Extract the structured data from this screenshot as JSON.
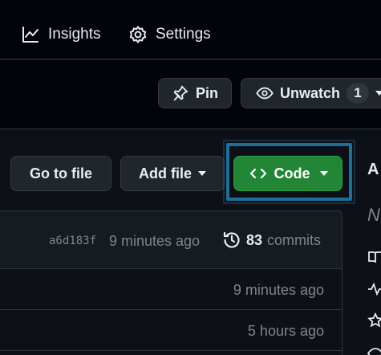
{
  "nav": {
    "insights_label": "Insights",
    "insights_icon": "graph-icon",
    "settings_label": "Settings",
    "settings_icon": "gear-icon"
  },
  "repo_actions": {
    "pin_label": "Pin",
    "pin_icon": "pin-icon",
    "unwatch_label": "Unwatch",
    "unwatch_icon": "eye-icon",
    "watch_count": "1"
  },
  "file_actions": {
    "go_to_file_label": "Go to file",
    "add_file_label": "Add file",
    "code_label": "Code",
    "code_icon": "code-brackets-icon"
  },
  "latest_commit": {
    "sha": "a6d183f",
    "time": "9 minutes ago",
    "commit_count": "83",
    "commits_label": "commits",
    "history_icon": "history-icon"
  },
  "file_rows": [
    {
      "time": "9 minutes ago"
    },
    {
      "time": "5 hours ago"
    }
  ],
  "sidebar": {
    "title_fragment": "A",
    "desc_fragment": "N"
  },
  "colors": {
    "background": "#0d1117",
    "nav_background": "#010409",
    "code_button": "#238636",
    "highlight": "#1f6f98"
  }
}
